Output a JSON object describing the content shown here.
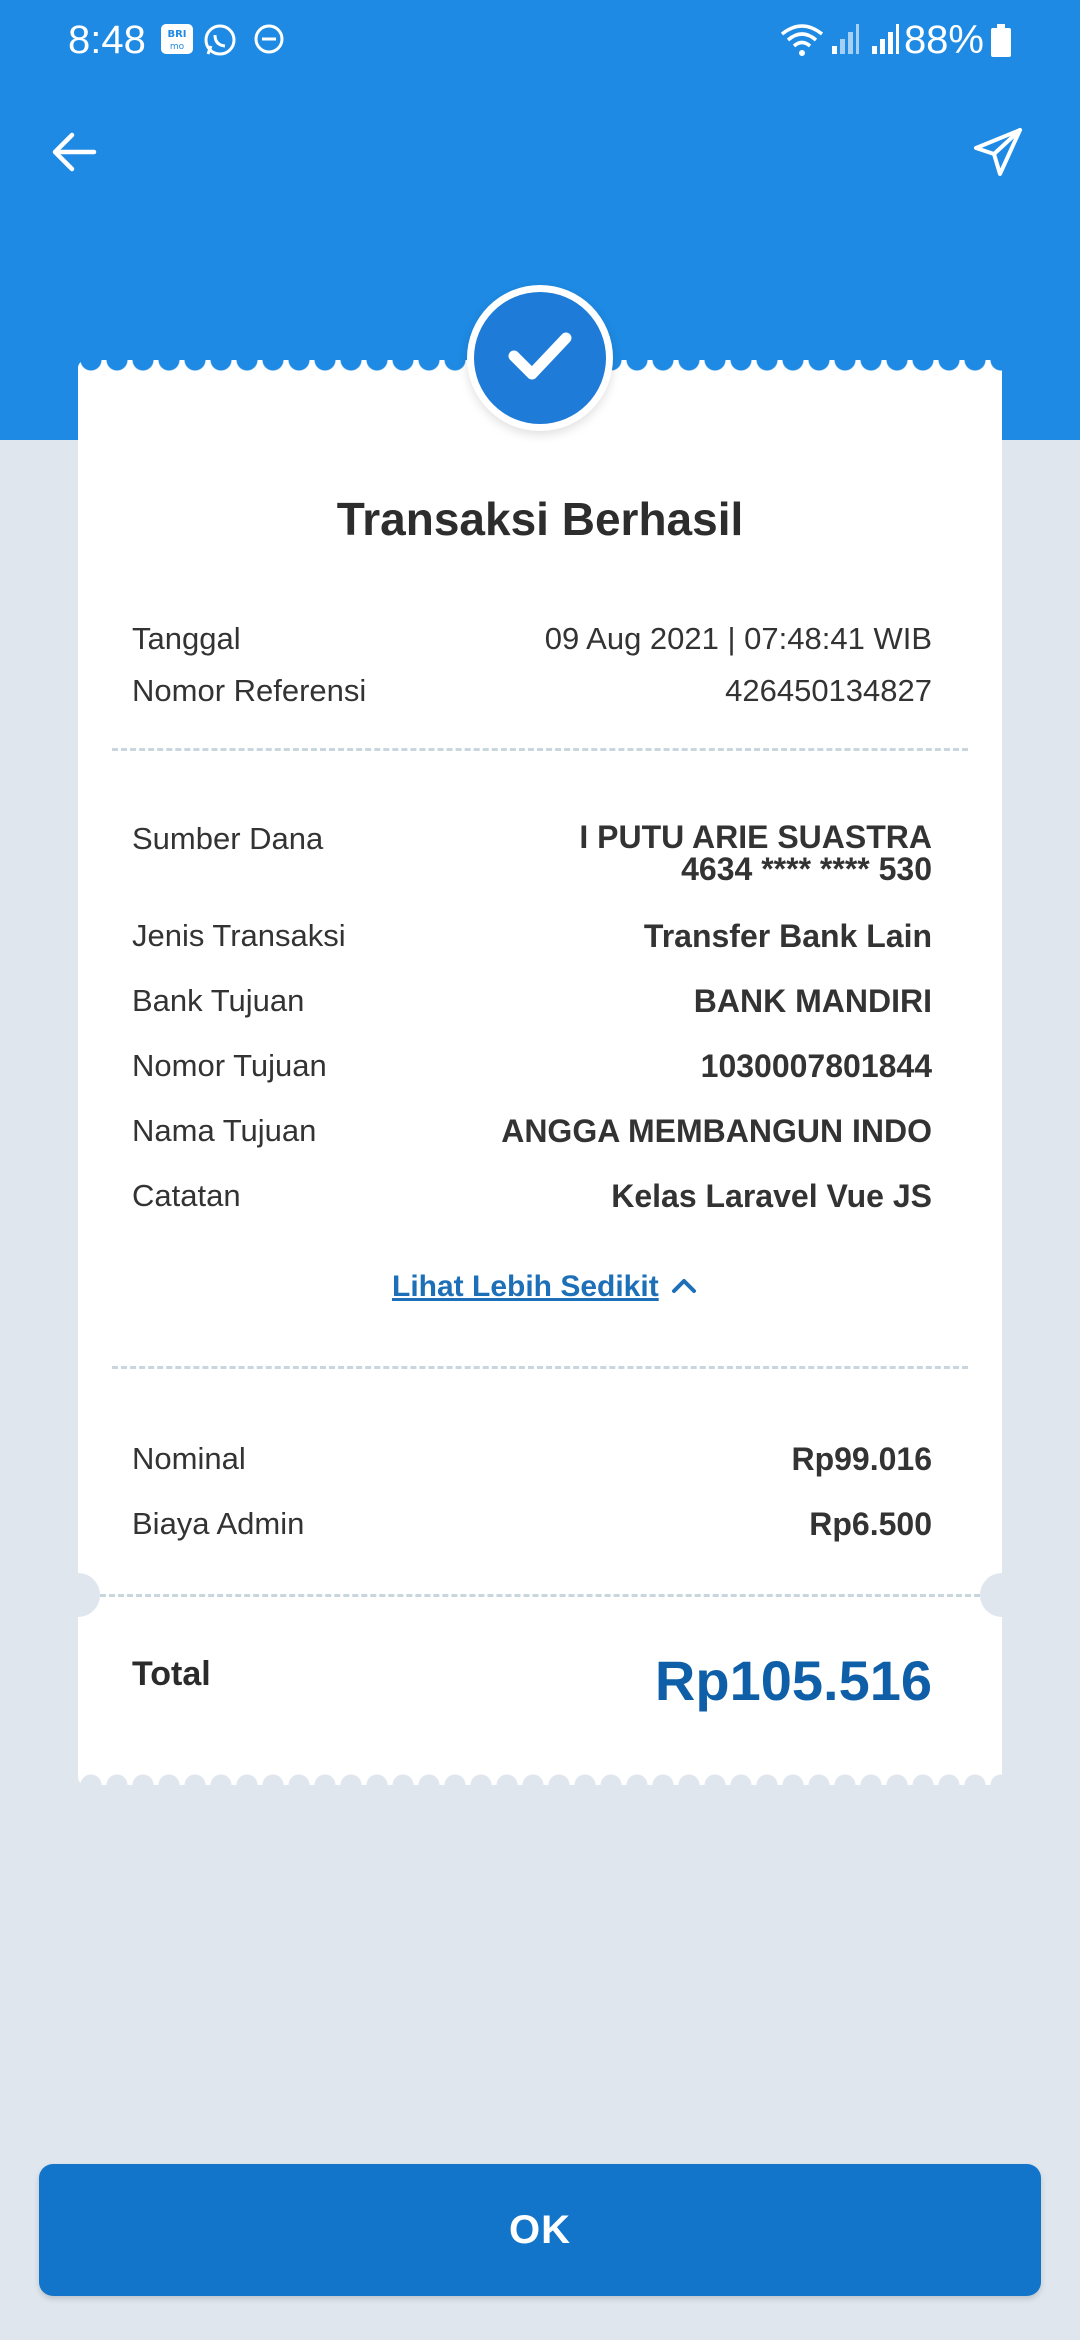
{
  "status_bar": {
    "time": "8:48",
    "battery": "88%",
    "icons": [
      "brimo-app-icon",
      "whatsapp-icon",
      "dnd-icon",
      "wifi-icon",
      "signal-icon",
      "signal-icon",
      "battery-icon"
    ]
  },
  "app_bar": {
    "back_icon": "arrow-left-icon",
    "share_icon": "send-icon"
  },
  "receipt": {
    "title": "Transaksi Berhasil",
    "meta": [
      {
        "label": "Tanggal",
        "value": "09 Aug 2021 | 07:48:41 WIB"
      },
      {
        "label": "Nomor Referensi",
        "value": "426450134827"
      }
    ],
    "source": {
      "label": "Sumber Dana",
      "name": "I PUTU ARIE SUASTRA",
      "account": "4634 **** **** 530"
    },
    "details": [
      {
        "label": "Jenis Transaksi",
        "value": "Transfer Bank Lain"
      },
      {
        "label": "Bank Tujuan",
        "value": "BANK MANDIRI"
      },
      {
        "label": "Nomor Tujuan",
        "value": "1030007801844"
      },
      {
        "label": "Nama Tujuan",
        "value": "ANGGA MEMBANGUN INDO"
      },
      {
        "label": "Catatan",
        "value": "Kelas Laravel Vue JS"
      }
    ],
    "toggle_label": "Lihat Lebih Sedikit",
    "amounts": [
      {
        "label": "Nominal",
        "value": "Rp99.016"
      },
      {
        "label": "Biaya Admin",
        "value": "Rp6.500"
      }
    ],
    "total_label": "Total",
    "total_value": "Rp105.516"
  },
  "ok_button": "OK",
  "colors": {
    "header": "#1e8ae3",
    "background": "#dfe6ee",
    "accent": "#1275c9",
    "total": "#0f5fa8"
  }
}
